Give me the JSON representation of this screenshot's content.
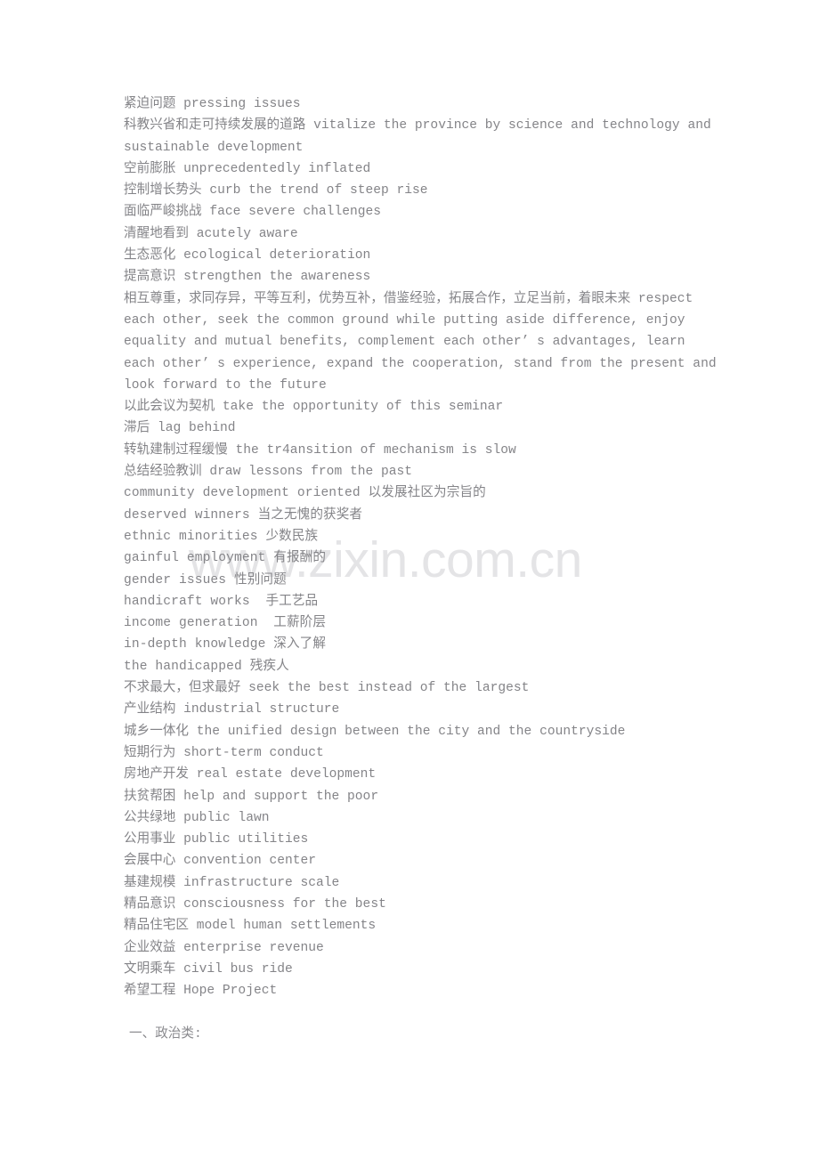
{
  "document": {
    "background_color": "#ffffff",
    "text_color": "#848488",
    "watermark": {
      "text": "www.zixin.com.cn",
      "color": "#e4e4e6"
    },
    "lines": [
      "紧迫问题 pressing issues",
      "科教兴省和走可持续发展的道路 vitalize the province by science and technology and sustainable development",
      "空前膨胀 unprecedentedly inflated",
      "控制增长势头 curb the trend of steep rise",
      "面临严峻挑战 face severe challenges",
      "清醒地看到 acutely aware",
      "生态恶化 ecological deterioration",
      "提高意识 strengthen the awareness",
      "相互尊重，求同存异，平等互利，优势互补，借鉴经验，拓展合作，立足当前，着眼未来 respect each other, seek the common ground while putting aside difference, enjoy equality and mutual benefits, complement each other’ s advantages, learn each other’ s experience, expand the cooperation, stand from the present and look forward to the future",
      "以此会议为契机 take the opportunity of this seminar",
      "滞后 lag behind",
      "转轨建制过程缓慢 the tr4ansition of mechanism is slow",
      "总结经验教训 draw lessons from the past",
      "community development oriented 以发展社区为宗旨的",
      "deserved winners 当之无愧的获奖者",
      "ethnic minorities 少数民族",
      "gainful employment 有报酬的",
      "gender issues 性别问题",
      "handicraft works  手工艺品",
      "income generation  工薪阶层",
      "in-depth knowledge 深入了解",
      "the handicapped 残疾人",
      "不求最大，但求最好 seek the best instead of the largest",
      "产业结构 industrial structure",
      "城乡一体化 the unified design between the city and the countryside",
      "短期行为 short-term conduct",
      "房地产开发 real estate development",
      "扶贫帮困 help and support the poor",
      "公共绿地 public lawn",
      "公用事业 public utilities",
      "会展中心 convention center",
      "基建规模 infrastructure scale",
      "精品意识 consciousness for the best",
      "精品住宅区 model human settlements",
      "企业效益 enterprise revenue",
      "文明乘车 civil bus ride",
      "希望工程 Hope Project"
    ],
    "section_heading": "一、政治类:"
  }
}
